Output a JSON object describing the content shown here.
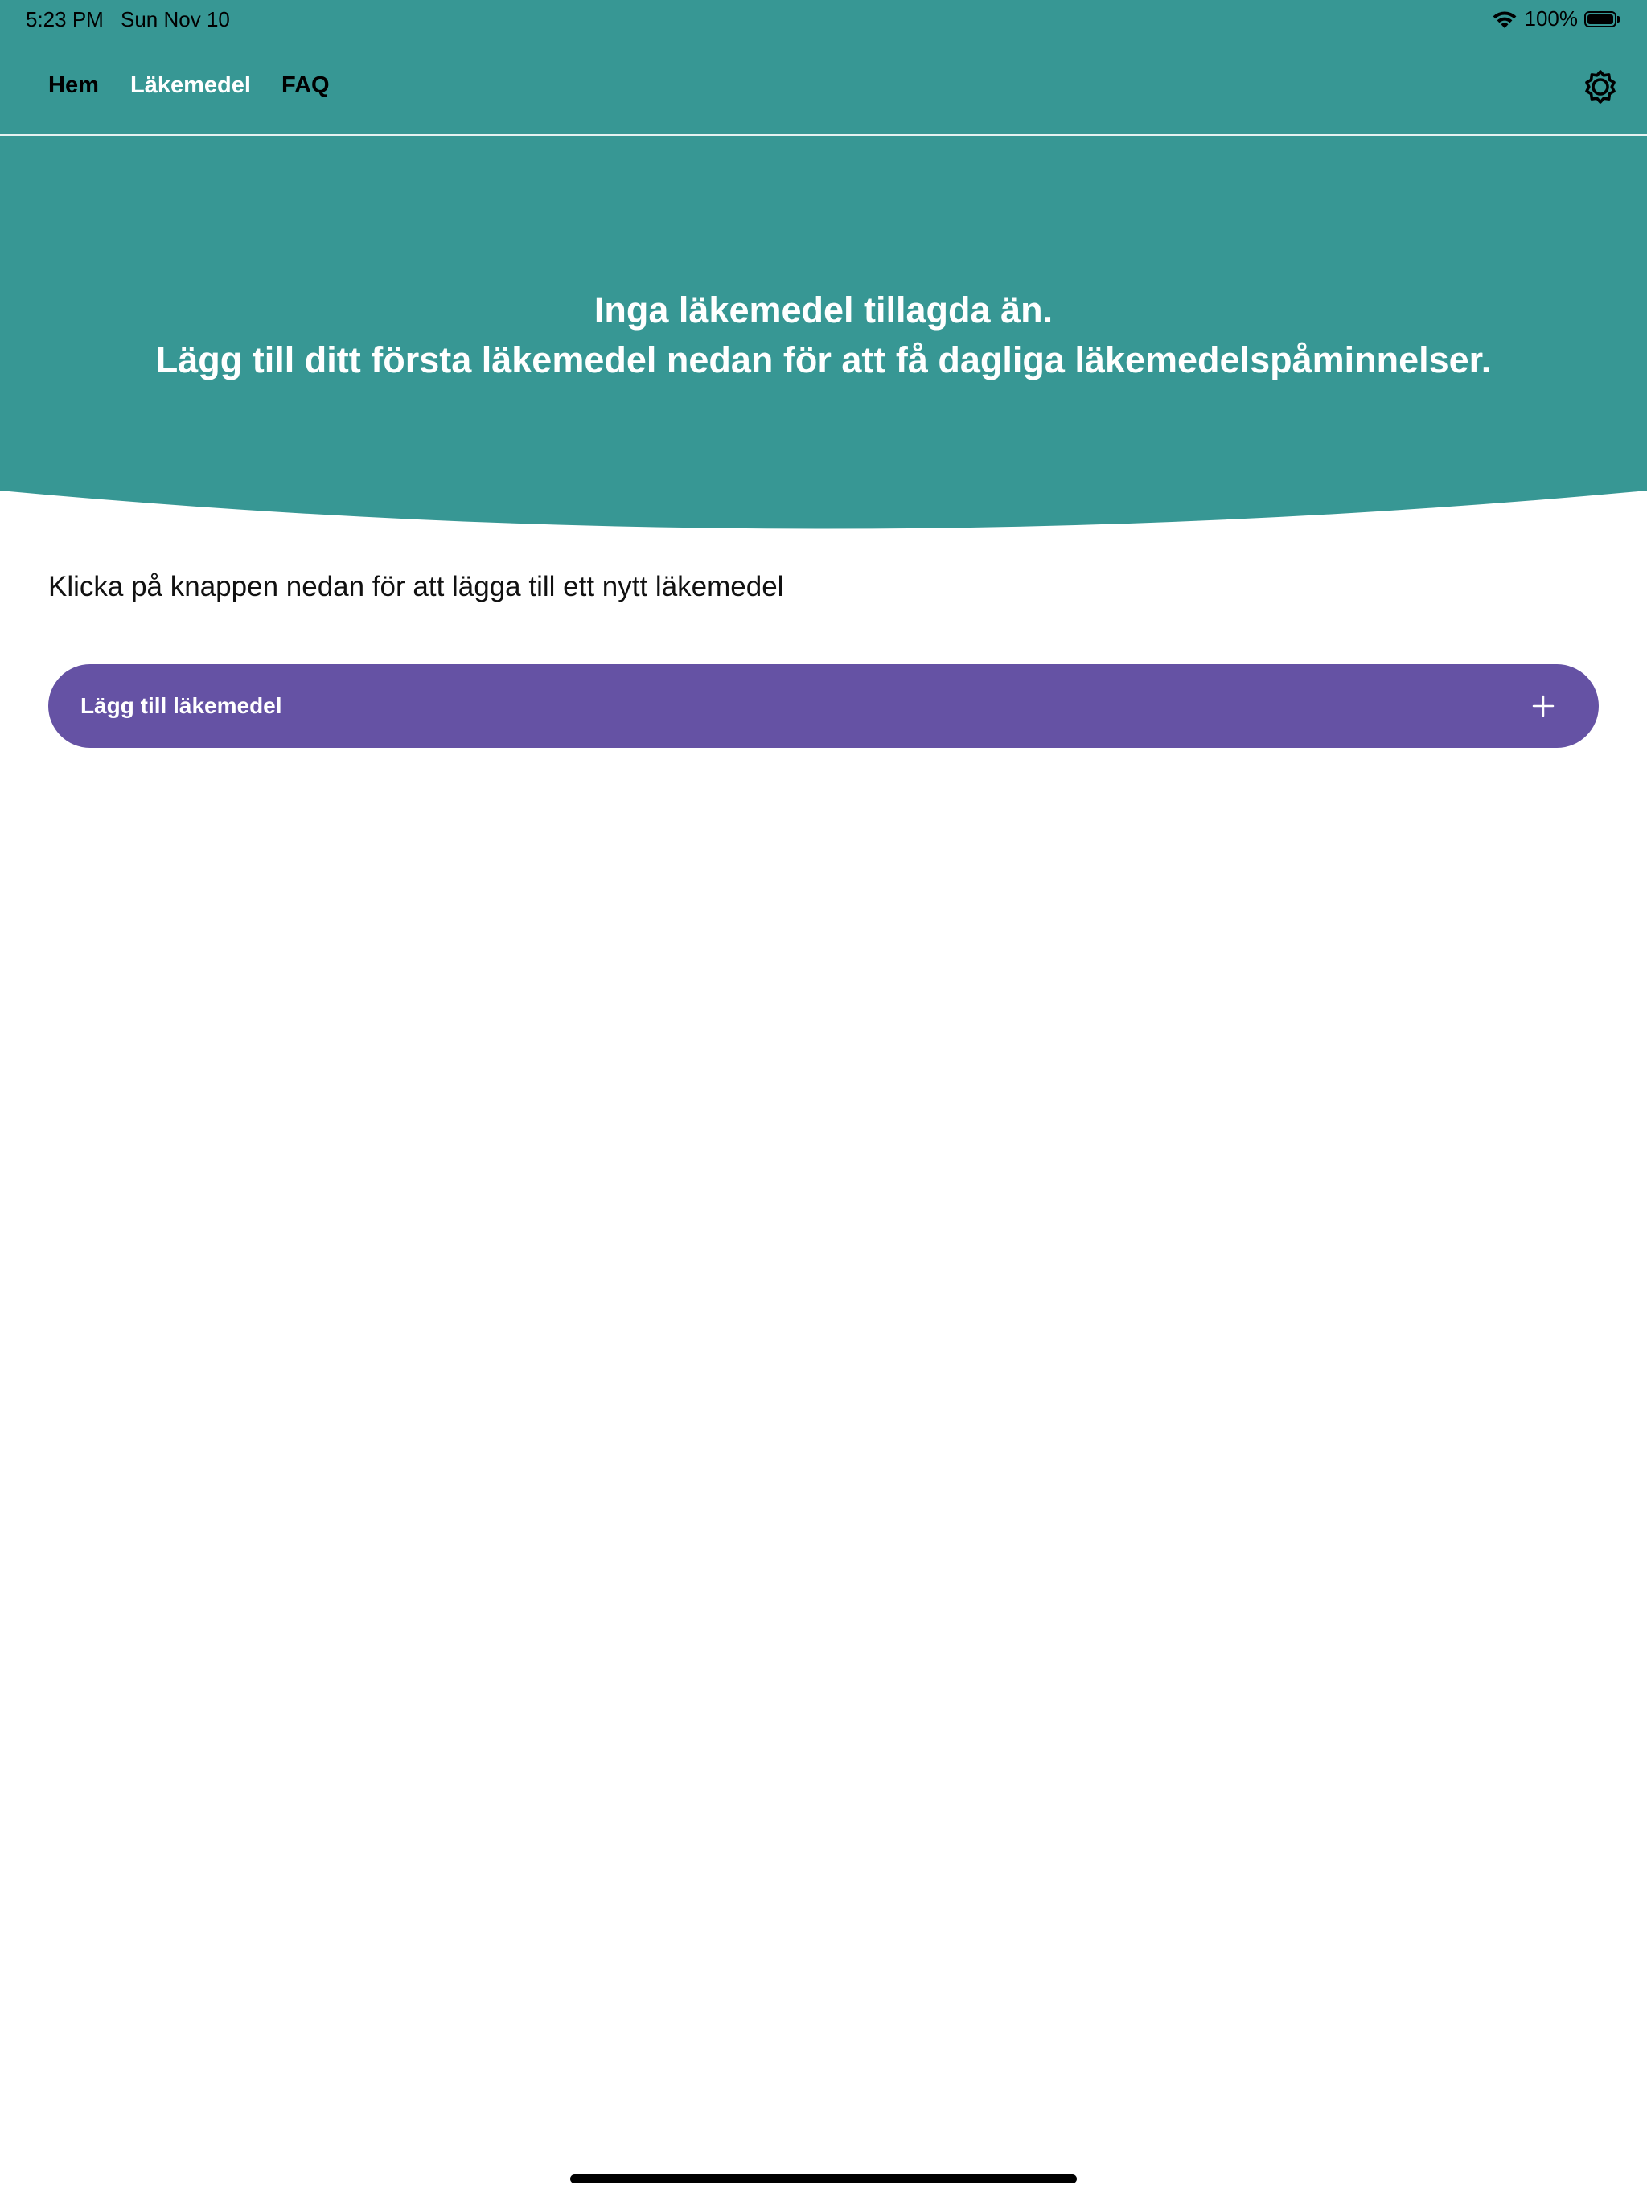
{
  "status_bar": {
    "time": "5:23 PM",
    "date": "Sun Nov 10",
    "battery_percent": "100%",
    "battery_level": 1.0,
    "wifi_icon": "wifi-icon",
    "battery_icon": "battery-icon"
  },
  "nav": {
    "tabs": [
      {
        "label": "Hem",
        "active": false
      },
      {
        "label": "Läkemedel",
        "active": true
      },
      {
        "label": "FAQ",
        "active": false
      }
    ],
    "settings_icon": "gear-icon"
  },
  "hero": {
    "line1": "Inga läkemedel tillagda än.",
    "line2": "Lägg till ditt första läkemedel nedan för att få dagliga läkemedelspåminnelser."
  },
  "main": {
    "instruction": "Klicka på knappen nedan för att lägga till ett nytt läkemedel",
    "add_button": {
      "label": "Lägg till läkemedel",
      "icon": "plus-icon"
    }
  },
  "colors": {
    "header_teal": "#379794",
    "button_purple": "#6552a4",
    "active_tab_text": "#ffffff",
    "inactive_tab_text": "#000000"
  }
}
